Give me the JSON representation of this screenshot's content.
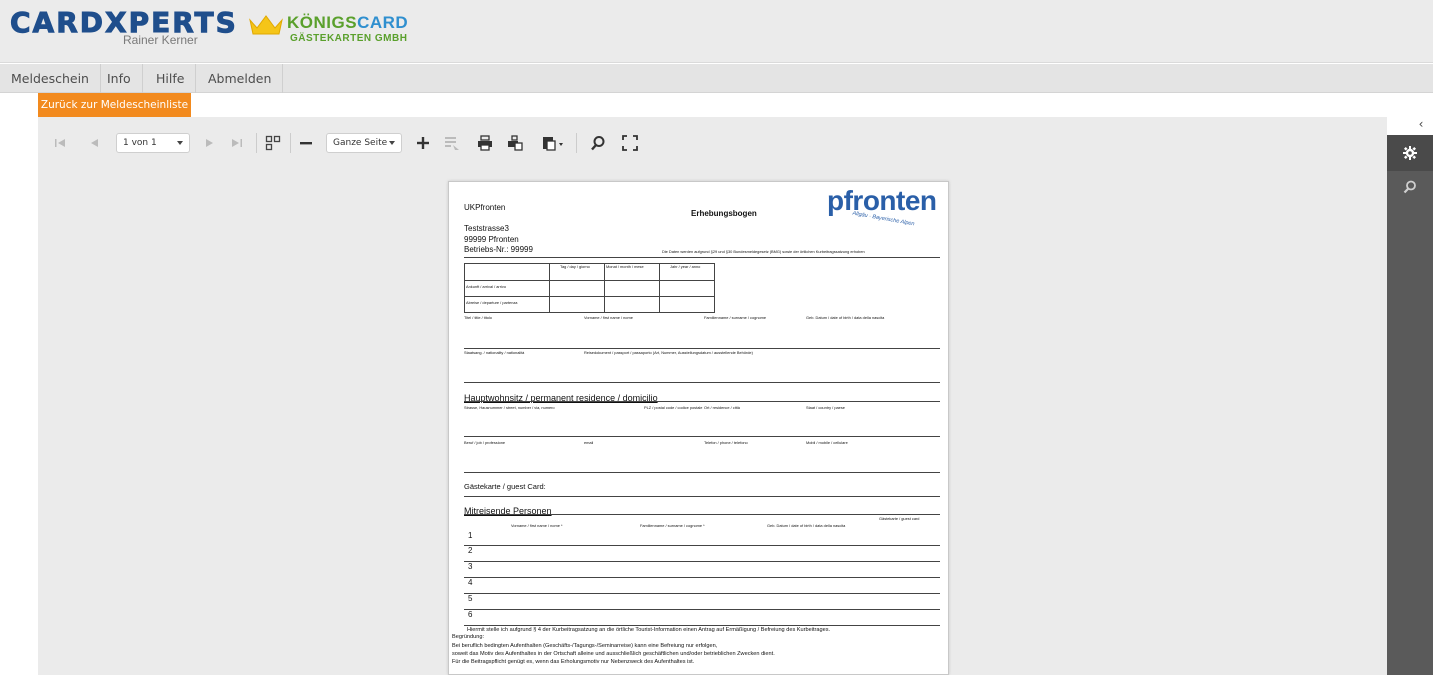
{
  "brand": {
    "logo_main": "CARDXPERTS",
    "logo_sub": "Rainer Kerner",
    "partner_main_a": "KÖNIGS",
    "partner_main_b": "CARD",
    "partner_sub": "GÄSTEKARTEN GMBH"
  },
  "menu": {
    "items": [
      {
        "label": "Meldeschein"
      },
      {
        "label": "Info"
      },
      {
        "label": "Hilfe"
      },
      {
        "label": "Abmelden"
      }
    ]
  },
  "back_button": "Zurück zur Meldescheinliste",
  "toolbar": {
    "page_select": "1 von 1",
    "zoom_select": "Ganze Seite"
  },
  "document": {
    "sender": "UKPfronten",
    "street": "Teststrasse3",
    "city": "99999  Pfronten",
    "business_no": "Betriebs-Nr.: 99999",
    "title": "Erhebungsbogen",
    "logo": "pfronten",
    "logo_tag": "Allgäu · Bayerische Alpen",
    "legal_note": "Die Daten werden aufgrund §29 und §30 Bundesmeldegesetz (BMG) sowie der örtlichen Kurbeitragssatzung erhoben",
    "date_cols": [
      "Tag / day / giorno",
      "Monat / month / mese",
      "Jahr / year / anno"
    ],
    "date_rows": [
      "Ankunft / arrival / arrivo",
      "Abreise / departure / partenza"
    ],
    "row1": [
      "Titel / title / titolo",
      "Vorname / first name / nome",
      "Familienname / surname / cognome",
      "Geb. Datum / date of birth / data della nascita"
    ],
    "row2": [
      "Staatsang. / nationality / nationalità",
      "Reisedokument / passport / passaporto (Art, Nummer, Ausstellungsdatum / ausstellende Behörde)"
    ],
    "residence_heading": "Hauptwohnsitz / permanent residence / domicilio",
    "row3": [
      "Strasse, Hausnummer / street, number / via, numero",
      "PLZ / postal code / codice postale",
      "Ort / residence / città",
      "Staat / country / paese"
    ],
    "row4": [
      "Beruf / job / professione",
      "email",
      "Telefon / phone / telefono",
      "Mobil / mobile / cellulare"
    ],
    "guest_card": "Gästekarte / guest Card:",
    "companions_heading": "Mitreisende Personen",
    "companion_cols": [
      "Vorname / first name / nome *",
      "Familienname / surname / cognome *",
      "Geb. Datum / date of birth / data della nascita",
      "Gästekarte / guest card"
    ],
    "companion_numbers": [
      "1",
      "2",
      "3",
      "4",
      "5",
      "6"
    ],
    "footer_lines": [
      "Hiermit stelle ich aufgrund § 4 der Kurbeitragsatzung an die örtliche Tourist-Information einen Antrag auf Ermäßigung / Befreiung des Kurbeitrages.",
      "Begründung:",
      "Bei beruflich bedingten Aufenthalten (Geschäfts-/Tagungs-/Seminarreise) kann eine Befreiung nur erfolgen,",
      "soweit das Motiv des Aufenthaltes in der Ortschaft alleine und ausschließlich geschäftlichen und/oder betrieblichen Zwecken dient.",
      "Für die Beitragspflicht genügt es, wenn das Erholungsmotiv nur Nebenzweck des Aufenthaltes ist."
    ]
  },
  "colors": {
    "brand_blue": "#1f4e8c",
    "accent_orange": "#f28a1e",
    "brand_green": "#5aa02c",
    "pfronten_blue": "#2a5fa8"
  }
}
